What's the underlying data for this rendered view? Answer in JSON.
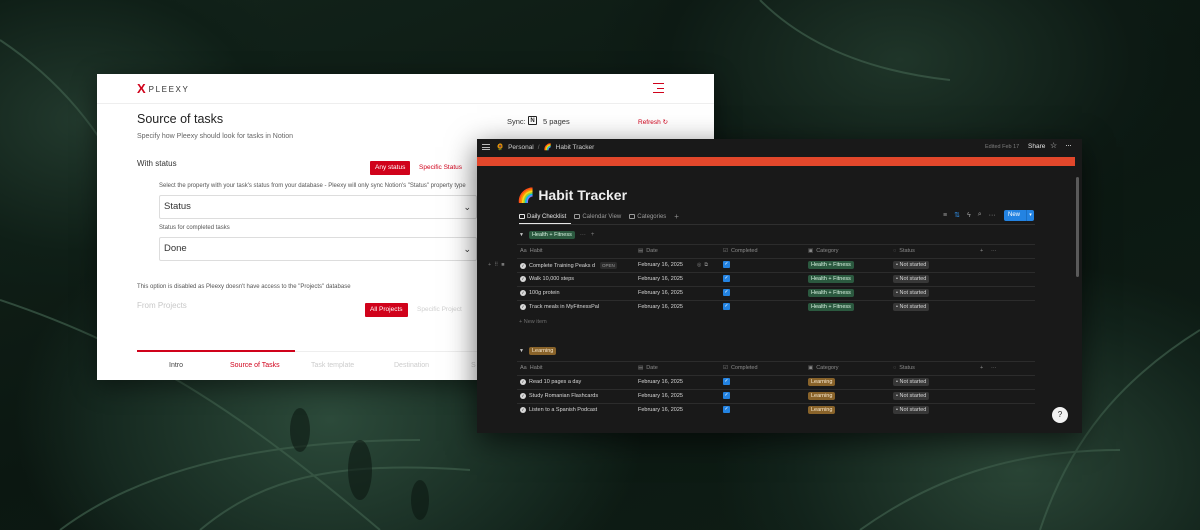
{
  "pleexy": {
    "logo_mark": "X",
    "logo_text": "PLEEXY",
    "title": "Source of tasks",
    "subtitle": "Specify how Pleexy should look for tasks in Notion",
    "sync_label": "Sync:",
    "sync_pages": "5 pages",
    "refresh_label": "Refresh",
    "with_status_label": "With status",
    "any_status_button": "Any status",
    "specific_status_button": "Specific Status",
    "status_property_desc": "Select the property with your task's status from your database - Pleexy will only sync Notion's \"Status\" property type",
    "status_property_value": "Status",
    "completed_label": "Status for completed tasks",
    "completed_value": "Done",
    "disabled_note": "This option is disabled as Pleexy doesn't have access to the \"Projects\" database",
    "from_projects_label": "From Projects",
    "all_projects_button": "All Projects",
    "specific_project_button": "Specific Project",
    "steps": [
      "Intro",
      "Source of Tasks",
      "Task template",
      "Destination",
      "S"
    ],
    "active_step": "Source of Tasks",
    "accent_color": "#d0021b"
  },
  "notion": {
    "breadcrumb": {
      "workspace": "Personal",
      "separator": "/",
      "page": "Habit Tracker"
    },
    "edited": "Edited Feb 17",
    "share_label": "Share",
    "title": "🌈 Habit Tracker",
    "tabs": [
      {
        "label": "Daily Checklist",
        "active": true
      },
      {
        "label": "Calendar View",
        "active": false
      },
      {
        "label": "Categories",
        "active": false
      }
    ],
    "new_button": "New",
    "columns": {
      "habit": "Habit",
      "date": "Date",
      "completed": "Completed",
      "category": "Category",
      "status": "Status"
    },
    "groups": [
      {
        "name": "Health + Fitness",
        "color": "fit",
        "rows": [
          {
            "habit": "Complete Training Peaks d",
            "open": "OPEN",
            "date": "February 16, 2025",
            "category": "Health + Fitness",
            "status": "Not started"
          },
          {
            "habit": "Walk 10,000 steps",
            "date": "February 16, 2025",
            "category": "Health + Fitness",
            "status": "Not started"
          },
          {
            "habit": "100g protein",
            "date": "February 16, 2025",
            "category": "Health + Fitness",
            "status": "Not started"
          },
          {
            "habit": "Track meals in MyFitnessPal",
            "date": "February 16, 2025",
            "category": "Health + Fitness",
            "status": "Not started"
          }
        ],
        "new_item": "+ New item"
      },
      {
        "name": "Learning",
        "color": "learn",
        "rows": [
          {
            "habit": "Read 10 pages a day",
            "date": "February 16, 2025",
            "category": "Learning",
            "status": "Not started"
          },
          {
            "habit": "Study Romanian Flashcards",
            "date": "February 16, 2025",
            "category": "Learning",
            "status": "Not started"
          },
          {
            "habit": "Listen to a Spanish Podcast",
            "date": "February 16, 2025",
            "category": "Learning",
            "status": "Not started"
          }
        ]
      }
    ],
    "banner_color": "#e2472b"
  }
}
